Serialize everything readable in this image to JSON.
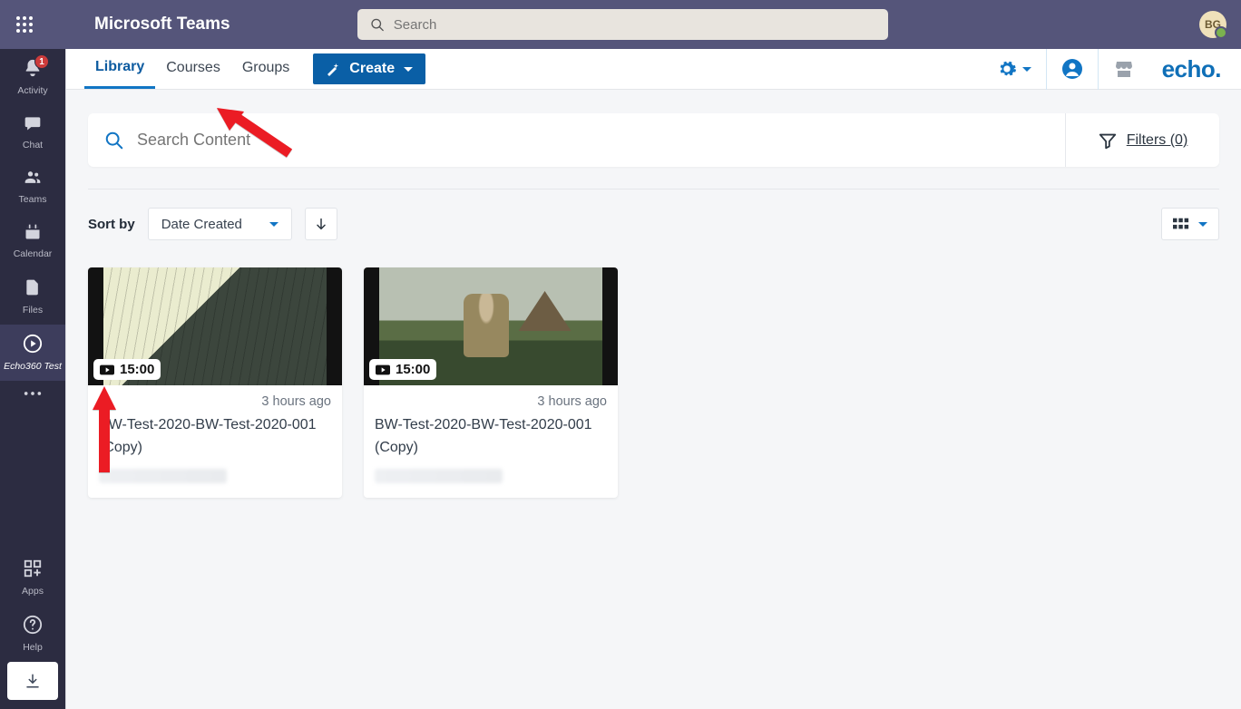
{
  "topbar": {
    "title": "Microsoft Teams",
    "search_placeholder": "Search",
    "avatar_initials": "BG"
  },
  "rail": {
    "items": [
      {
        "id": "activity",
        "label": "Activity",
        "badge": "1"
      },
      {
        "id": "chat",
        "label": "Chat"
      },
      {
        "id": "teams",
        "label": "Teams"
      },
      {
        "id": "calendar",
        "label": "Calendar"
      },
      {
        "id": "files",
        "label": "Files"
      },
      {
        "id": "echo",
        "label": "Echo360 Test"
      },
      {
        "id": "more",
        "label": ""
      }
    ],
    "apps_label": "Apps",
    "help_label": "Help"
  },
  "echo_nav": {
    "tabs": [
      "Library",
      "Courses",
      "Groups"
    ],
    "create_label": "Create",
    "brand_text": "echo"
  },
  "search_card": {
    "placeholder": "Search Content",
    "filters_label": "Filters (0)"
  },
  "sort": {
    "label": "Sort by",
    "selected": "Date Created"
  },
  "cards": [
    {
      "duration": "15:00",
      "date": "3 hours ago",
      "title": "BW-Test-2020-BW-Test-2020-001 (Copy)"
    },
    {
      "duration": "15:00",
      "date": "3 hours ago",
      "title": "BW-Test-2020-BW-Test-2020-001 (Copy)"
    }
  ]
}
